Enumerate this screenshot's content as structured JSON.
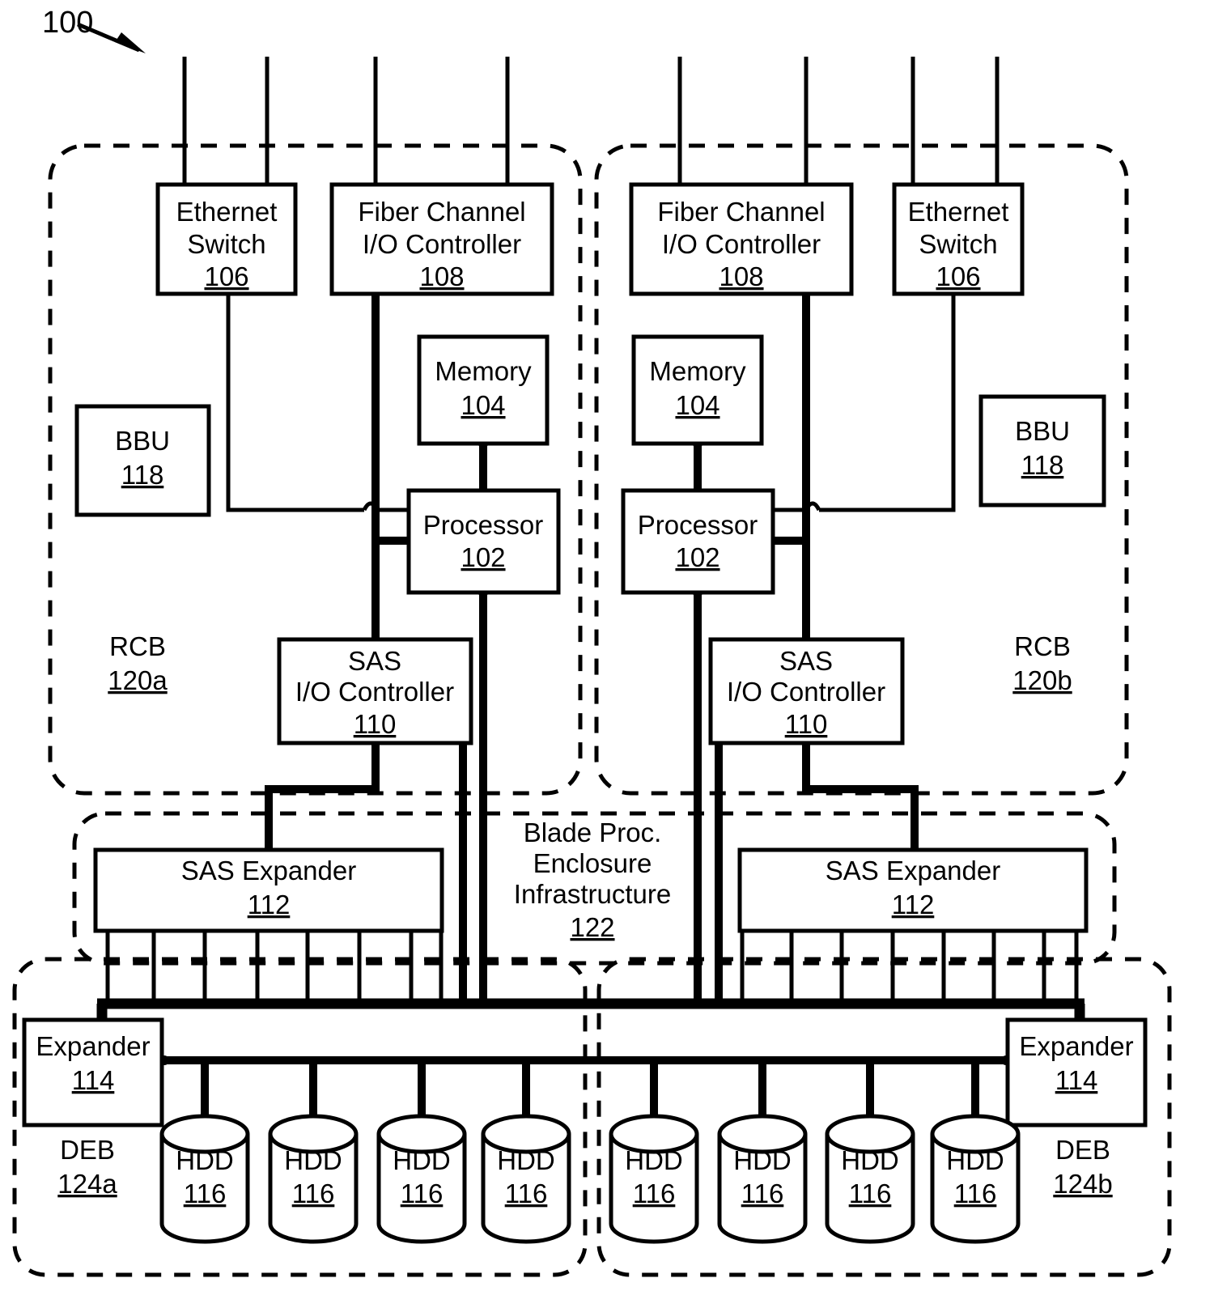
{
  "figure": {
    "ref_number": "100",
    "title_label": "100"
  },
  "groups": {
    "rcb_a": {
      "label": "RCB",
      "number": "120a"
    },
    "rcb_b": {
      "label": "RCB",
      "number": "120b"
    },
    "enclosure": {
      "line1": "Blade Proc.",
      "line2": "Enclosure",
      "line3": "Infrastructure",
      "number": "122"
    },
    "deb_a": {
      "label": "DEB",
      "number": "124a"
    },
    "deb_b": {
      "label": "DEB",
      "number": "124b"
    }
  },
  "blocks": {
    "ethernet_switch_left": {
      "line1": "Ethernet",
      "line2": "Switch",
      "number": "106"
    },
    "ethernet_switch_right": {
      "line1": "Ethernet",
      "line2": "Switch",
      "number": "106"
    },
    "fiber_channel_left": {
      "line1": "Fiber Channel",
      "line2": "I/O Controller",
      "number": "108"
    },
    "fiber_channel_right": {
      "line1": "Fiber Channel",
      "line2": "I/O Controller",
      "number": "108"
    },
    "memory_left": {
      "line1": "Memory",
      "number": "104"
    },
    "memory_right": {
      "line1": "Memory",
      "number": "104"
    },
    "processor_left": {
      "line1": "Processor",
      "number": "102"
    },
    "processor_right": {
      "line1": "Processor",
      "number": "102"
    },
    "bbu_left": {
      "line1": "BBU",
      "number": "118"
    },
    "bbu_right": {
      "line1": "BBU",
      "number": "118"
    },
    "sas_io_left": {
      "line1": "SAS",
      "line2": "I/O Controller",
      "number": "110"
    },
    "sas_io_right": {
      "line1": "SAS",
      "line2": "I/O Controller",
      "number": "110"
    },
    "sas_expander_left": {
      "line1": "SAS Expander",
      "number": "112"
    },
    "sas_expander_right": {
      "line1": "SAS Expander",
      "number": "112"
    },
    "expander_left": {
      "line1": "Expander",
      "number": "114"
    },
    "expander_right": {
      "line1": "Expander",
      "number": "114"
    }
  },
  "hdds_left": [
    {
      "label": "HDD",
      "number": "116"
    },
    {
      "label": "HDD",
      "number": "116"
    },
    {
      "label": "HDD",
      "number": "116"
    },
    {
      "label": "HDD",
      "number": "116"
    }
  ],
  "hdds_right": [
    {
      "label": "HDD",
      "number": "116"
    },
    {
      "label": "HDD",
      "number": "116"
    },
    {
      "label": "HDD",
      "number": "116"
    },
    {
      "label": "HDD",
      "number": "116"
    }
  ],
  "colors": {
    "line": "#000000",
    "fill": "#ffffff"
  }
}
